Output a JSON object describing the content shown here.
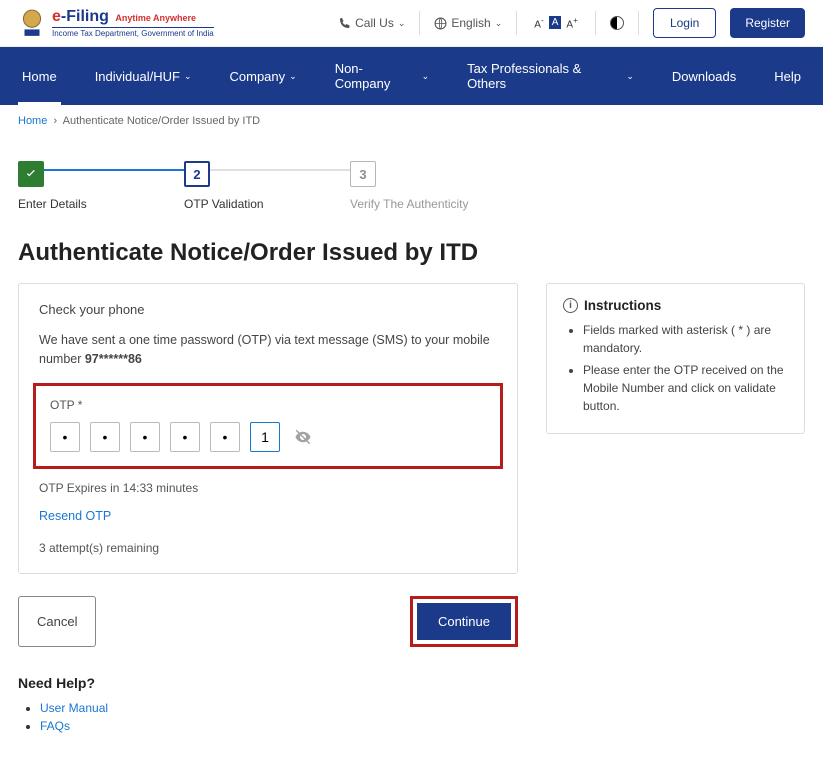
{
  "header": {
    "logo_e": "e",
    "logo_filing": "-Filing",
    "logo_tag": "Anytime Anywhere",
    "logo_sub": "Income Tax Department, Government of India",
    "call_us": "Call Us",
    "language": "English",
    "login": "Login",
    "register": "Register"
  },
  "nav": {
    "home": "Home",
    "individual": "Individual/HUF",
    "company": "Company",
    "noncompany": "Non-Company",
    "taxprof": "Tax Professionals & Others",
    "downloads": "Downloads",
    "help": "Help"
  },
  "breadcrumb": {
    "home": "Home",
    "current": "Authenticate Notice/Order Issued by ITD"
  },
  "steps": {
    "s1": "Enter Details",
    "s2": "OTP Validation",
    "s3": "Verify The Authenticity",
    "n2": "2",
    "n3": "3"
  },
  "page_title": "Authenticate Notice/Order Issued by ITD",
  "card": {
    "subtitle": "Check your phone",
    "msg_pre": "We have sent a one time password (OTP) via text message (SMS) to your mobile number ",
    "msg_mobile": "97******86",
    "otp_label": "OTP *",
    "otp6": "1",
    "expire": "OTP Expires in 14:33 minutes",
    "resend": "Resend OTP",
    "attempts": "3 attempt(s) remaining"
  },
  "actions": {
    "cancel": "Cancel",
    "continue": "Continue"
  },
  "help": {
    "title": "Need Help?",
    "manual": "User Manual",
    "faqs": "FAQs"
  },
  "info": {
    "title": "Instructions",
    "i1": "Fields marked with asterisk ( * ) are mandatory.",
    "i2": "Please enter the OTP received on the Mobile Number and click on validate button."
  }
}
